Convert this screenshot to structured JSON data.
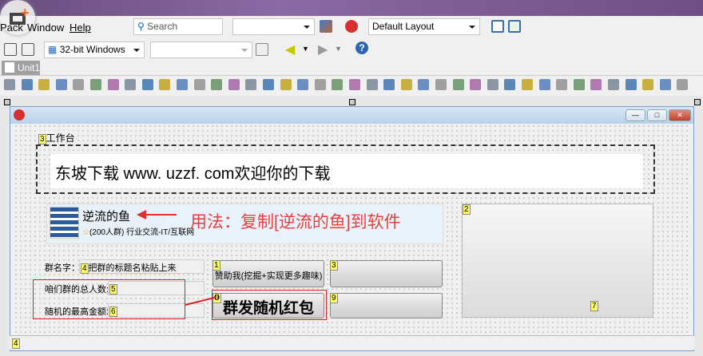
{
  "menu": {
    "pack": "Pack",
    "window": "Window",
    "help": "Help"
  },
  "toolbar1": {
    "search_placeholder": "Search",
    "layout": "Default Layout"
  },
  "toolbar2": {
    "platform": "32-bit Windows",
    "config": ""
  },
  "tab": {
    "label": "Unit1"
  },
  "form": {
    "group_label": "工作台",
    "group_marker": "3",
    "banner_text": "东坡下载  www. uzzf. com欢迎你的下载",
    "qq_group": {
      "name": "逆流的鱼",
      "info": "(200人群) 行业交流-IT/互联网"
    },
    "usage_text": "用法：复制[逆流的鱼]到软件",
    "group_name_label": "群名字：",
    "group_name_marker": "4",
    "group_name_value": "把群的标题名粘贴上来",
    "total_label": "咱们群的总人数:",
    "total_marker": "5",
    "max_label": "随机的最高金额:",
    "max_marker": "6",
    "sponsor_marker": "1",
    "sponsor_label": "赞助我(挖掘+实现更多趣味)",
    "send_marker": "0",
    "send_label": "群发随机红包",
    "btn3_marker": "3",
    "btn9_marker": "9",
    "panel_marker": "2",
    "panel_marker2": "7",
    "status_marker": "4"
  },
  "colors": {
    "accent_red": "#e02020",
    "title_blue": "#b9d1ea"
  }
}
